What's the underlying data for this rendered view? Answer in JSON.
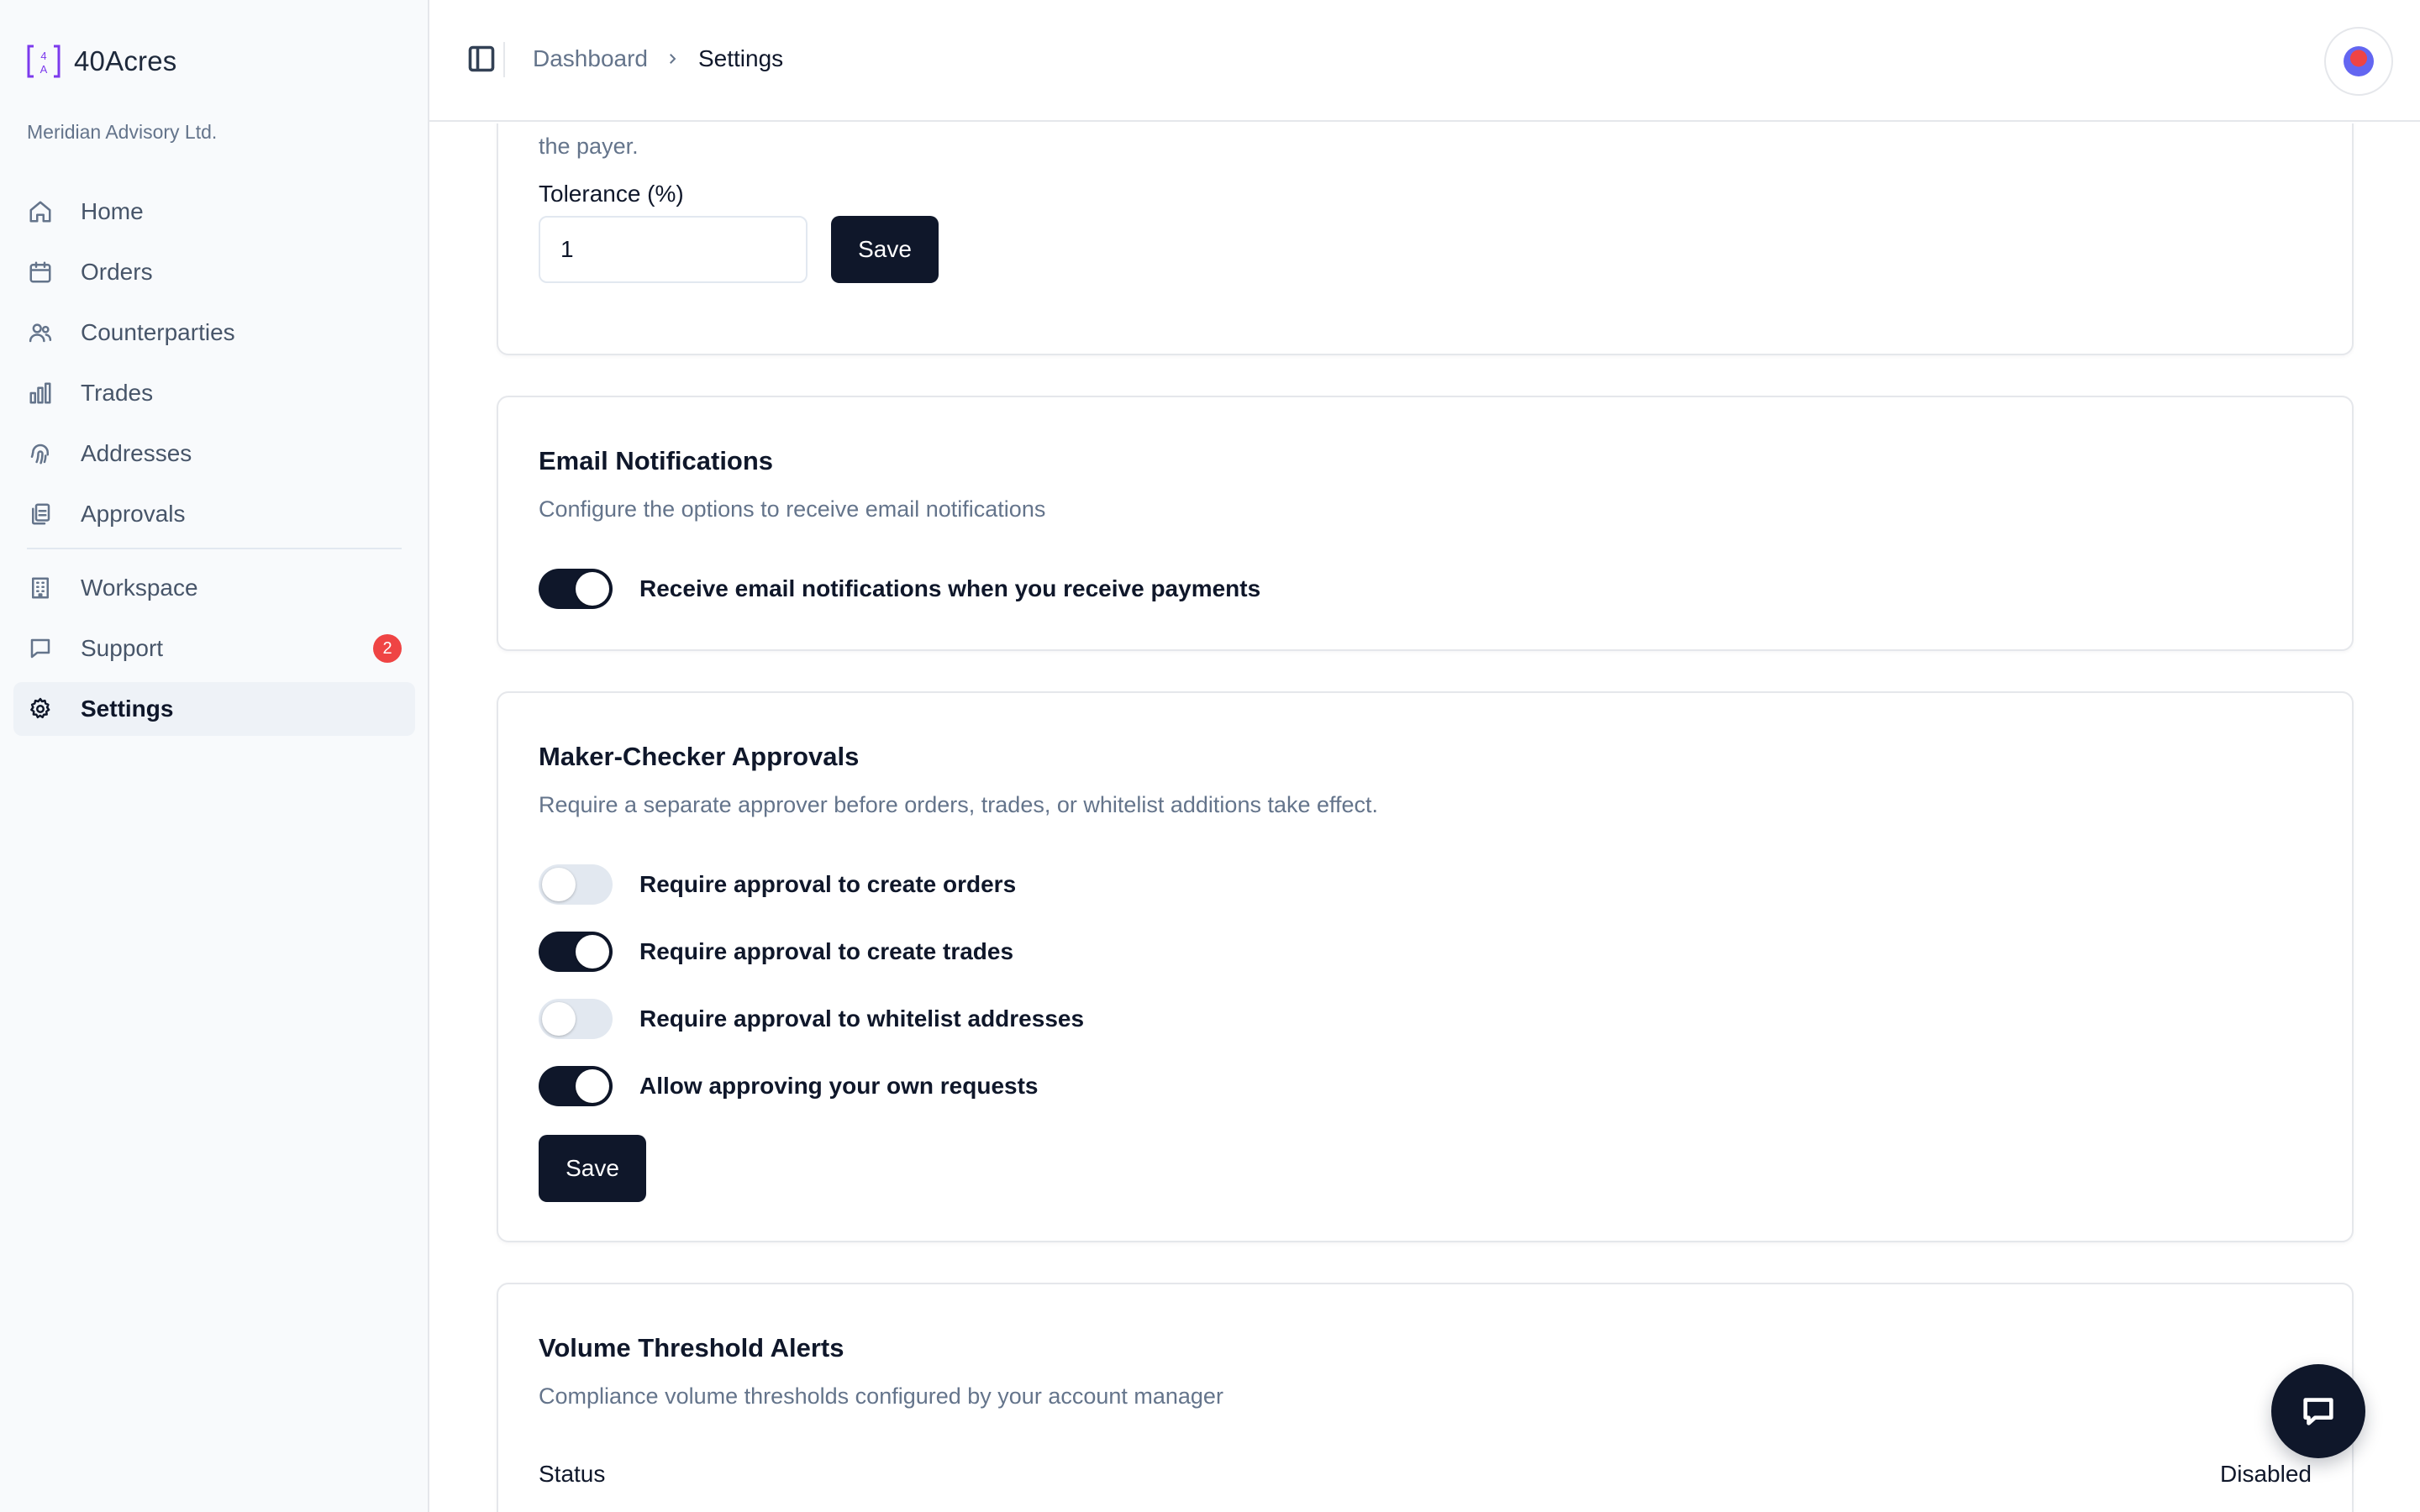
{
  "app": {
    "name": "40Acres",
    "org": "Meridian Advisory Ltd."
  },
  "sidebar": {
    "items": [
      {
        "label": "Home",
        "icon": "home-icon"
      },
      {
        "label": "Orders",
        "icon": "calendar-icon"
      },
      {
        "label": "Counterparties",
        "icon": "users-icon"
      },
      {
        "label": "Trades",
        "icon": "bar-chart-icon"
      },
      {
        "label": "Addresses",
        "icon": "fingerprint-icon"
      },
      {
        "label": "Approvals",
        "icon": "clipboard-copy-icon"
      }
    ],
    "secondary": [
      {
        "label": "Workspace",
        "icon": "building-icon"
      },
      {
        "label": "Support",
        "icon": "message-square-icon",
        "badge": "2"
      },
      {
        "label": "Settings",
        "icon": "gear-icon",
        "active": true
      }
    ]
  },
  "header": {
    "breadcrumb": {
      "parent": "Dashboard",
      "current": "Settings"
    }
  },
  "tolerance_card": {
    "desc_tail": "the payer.",
    "field_label": "Tolerance (%)",
    "value": "1",
    "save_label": "Save"
  },
  "email_card": {
    "title": "Email Notifications",
    "desc": "Configure the options to receive email notifications",
    "toggle": {
      "label": "Receive email notifications when you receive payments",
      "on": true
    }
  },
  "approvals_card": {
    "title": "Maker-Checker Approvals",
    "desc": "Require a separate approver before orders, trades, or whitelist additions take effect.",
    "toggles": [
      {
        "label": "Require approval to create orders",
        "on": false
      },
      {
        "label": "Require approval to create trades",
        "on": true
      },
      {
        "label": "Require approval to whitelist addresses",
        "on": false
      },
      {
        "label": "Allow approving your own requests",
        "on": true
      }
    ],
    "save_label": "Save"
  },
  "volume_card": {
    "title": "Volume Threshold Alerts",
    "desc": "Compliance volume thresholds configured by your account manager",
    "status_label": "Status",
    "status_value": "Disabled"
  },
  "colors": {
    "primary": "#0f172a",
    "badge": "#ef4444",
    "brand": "#7c3aed"
  }
}
